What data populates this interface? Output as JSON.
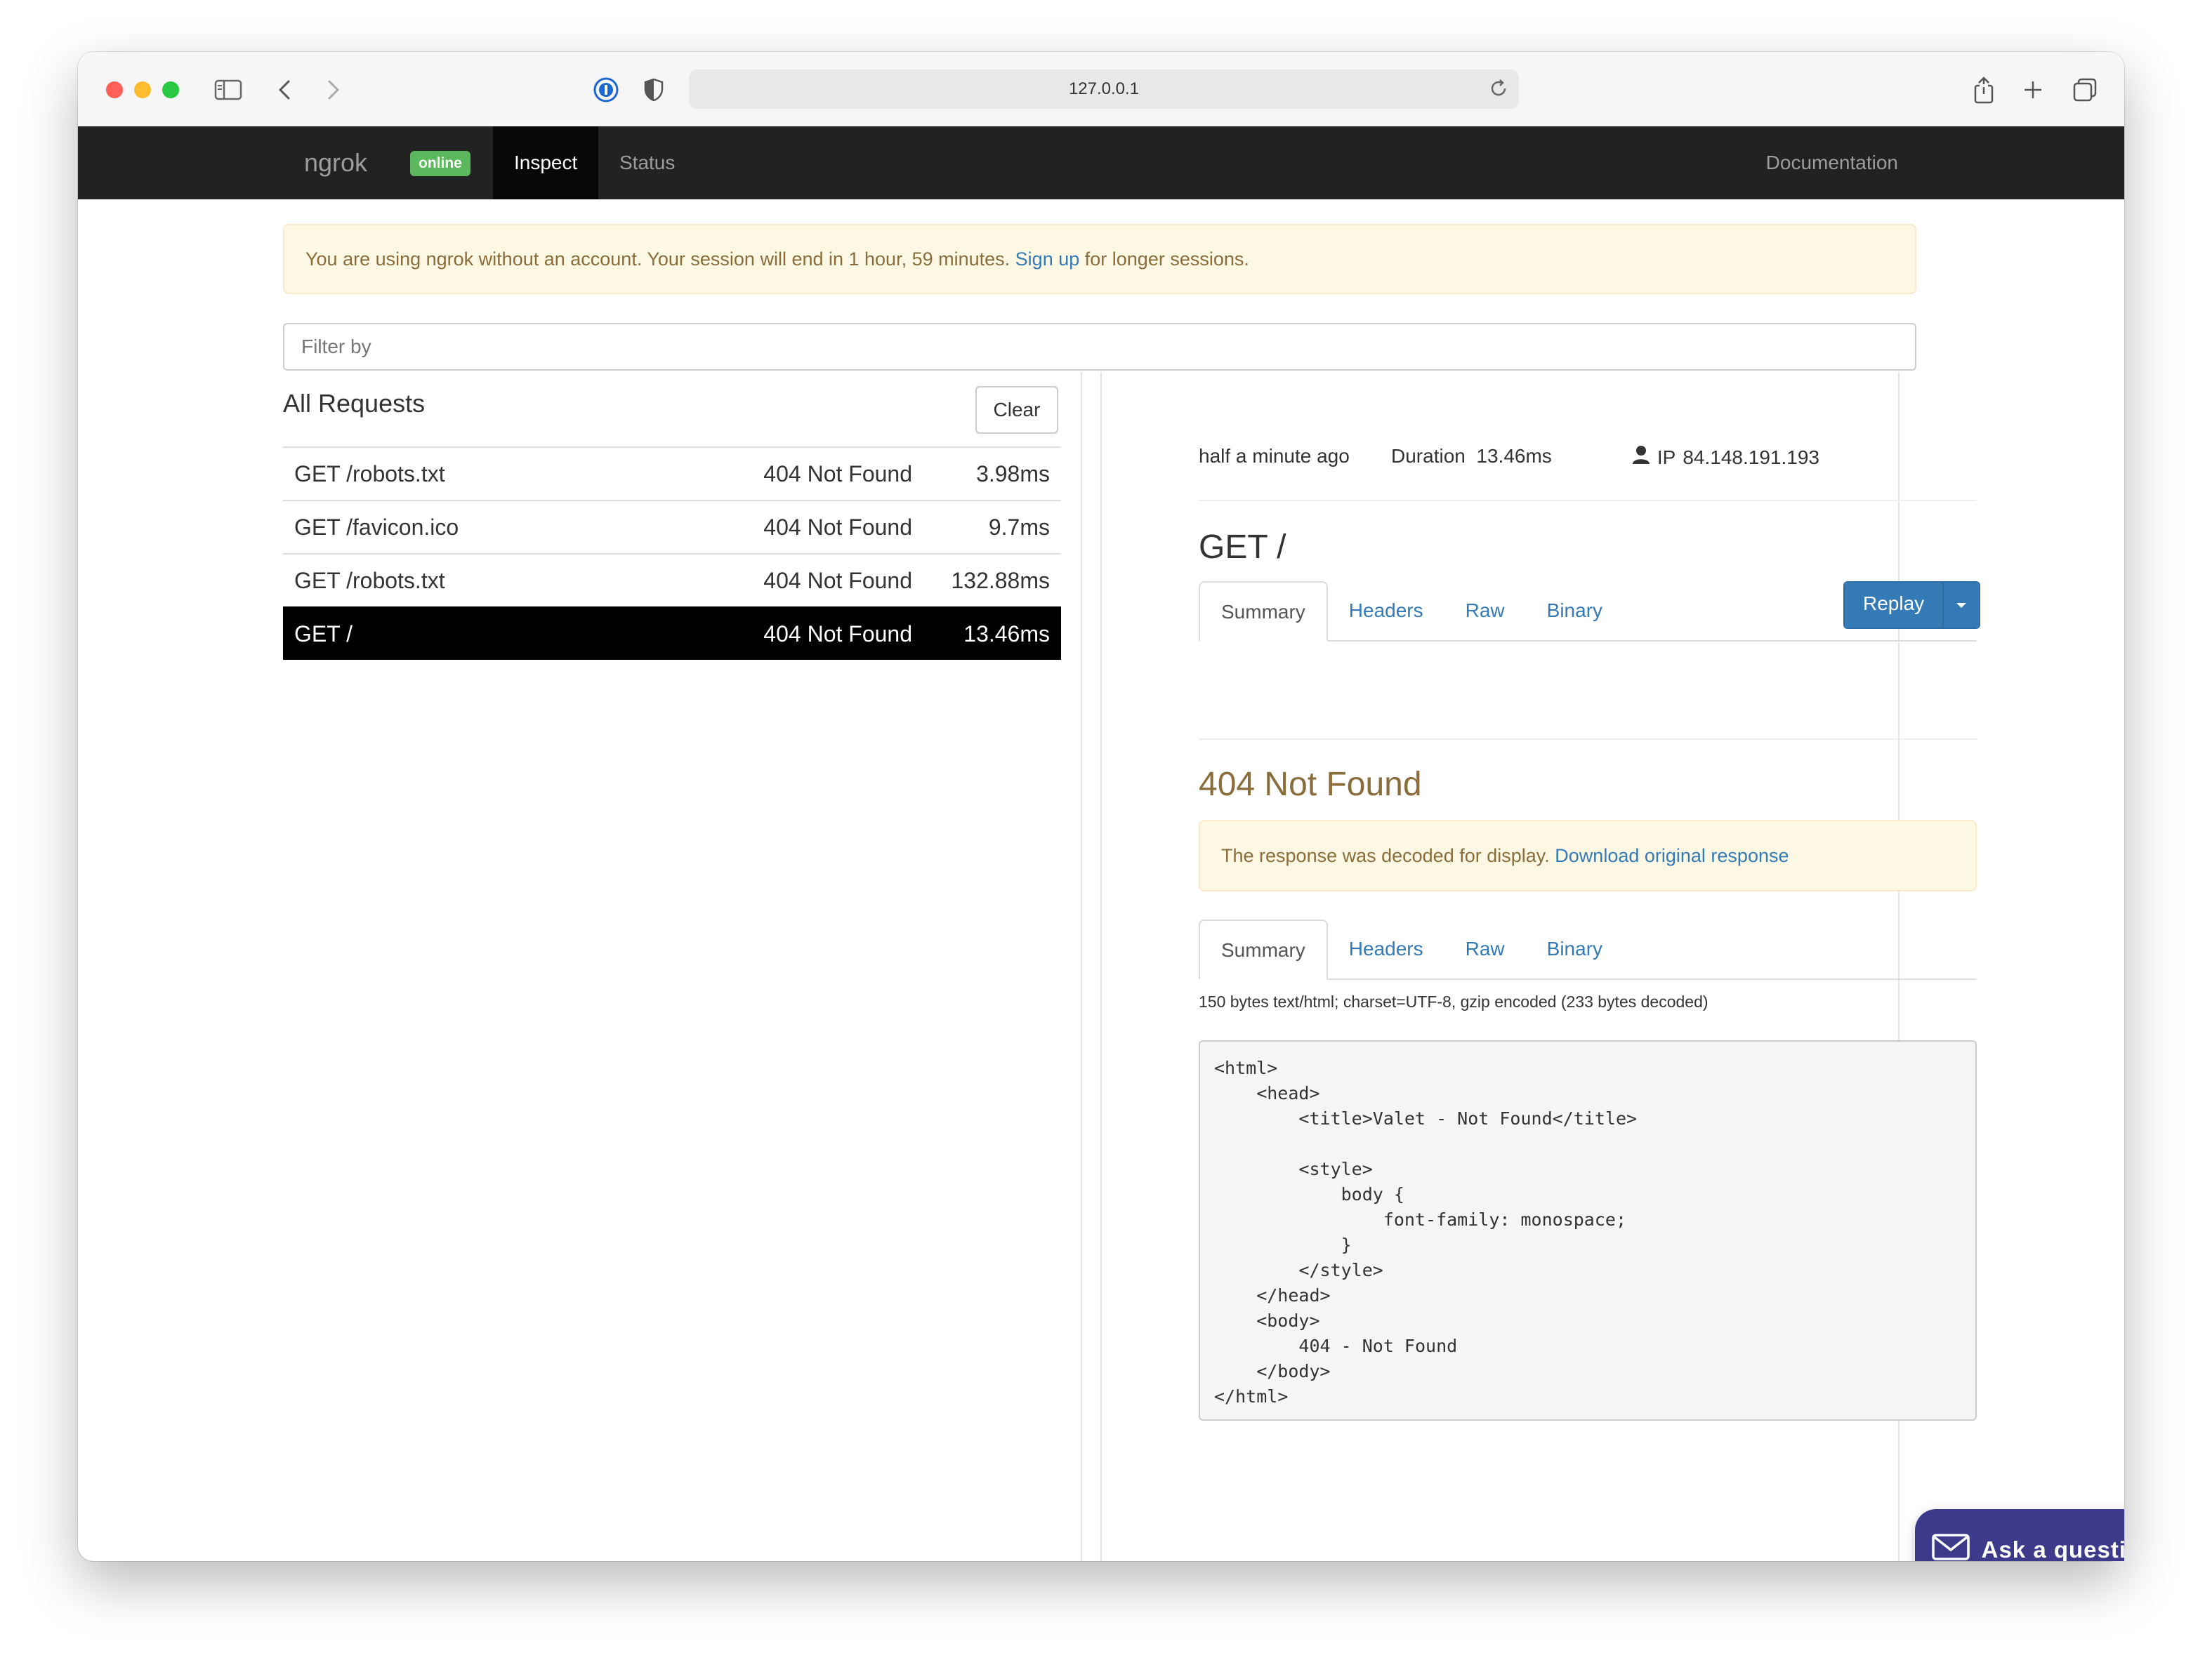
{
  "browser": {
    "url": "127.0.0.1"
  },
  "navbar": {
    "brand": "ngrok",
    "status_badge": "online",
    "tabs": [
      {
        "label": "Inspect",
        "active": true
      },
      {
        "label": "Status",
        "active": false
      }
    ],
    "documentation": "Documentation"
  },
  "session_alert": {
    "text": "You are using ngrok without an account. Your session will end in 1 hour, 59 minutes.",
    "link": "Sign up",
    "suffix": "for longer sessions."
  },
  "filter": {
    "placeholder": "Filter by"
  },
  "requests": {
    "title": "All Requests",
    "clear_label": "Clear",
    "rows": [
      {
        "path": "GET /robots.txt",
        "status": "404 Not Found",
        "duration": "3.98ms",
        "selected": false
      },
      {
        "path": "GET /favicon.ico",
        "status": "404 Not Found",
        "duration": "9.7ms",
        "selected": false
      },
      {
        "path": "GET /robots.txt",
        "status": "404 Not Found",
        "duration": "132.88ms",
        "selected": false
      },
      {
        "path": "GET /",
        "status": "404 Not Found",
        "duration": "13.46ms",
        "selected": true
      }
    ]
  },
  "detail": {
    "time": "half a minute ago",
    "duration_label": "Duration",
    "duration_value": "13.46ms",
    "ip_label": "IP",
    "ip_value": "84.148.191.193",
    "request_title": "GET /",
    "request_tabs": [
      "Summary",
      "Headers",
      "Raw",
      "Binary"
    ],
    "replay_label": "Replay",
    "response_title": "404 Not Found",
    "decoded_notice": "The response was decoded for display.",
    "download_link": "Download original response",
    "response_tabs": [
      "Summary",
      "Headers",
      "Raw",
      "Binary"
    ],
    "response_info": "150 bytes text/html; charset=UTF-8, gzip encoded (233 bytes decoded)",
    "body": "<html>\n    <head>\n        <title>Valet - Not Found</title>\n\n        <style>\n            body {\n                font-family: monospace;\n            }\n        </style>\n    </head>\n    <body>\n        404 - Not Found\n    </body>\n</html>"
  },
  "support": {
    "ask_label": "Ask a question"
  },
  "colors": {
    "navbar_bg": "#222222",
    "online_badge": "#5cb85c",
    "selected_row": "#000000",
    "link": "#337ab7",
    "alert_bg": "#fcf8e3",
    "response_status": "#8a6d3b",
    "ask_button": "#3d3a8c"
  },
  "icons": {
    "sidebar": "sidebar-icon",
    "back": "chevron-left-icon",
    "forward": "chevron-right-icon",
    "password": "password-manager-icon",
    "shield": "shield-icon",
    "reload": "reload-icon",
    "share": "share-icon",
    "new_tab": "plus-icon",
    "tabs": "tabs-overview-icon",
    "user": "user-icon",
    "mail": "mail-icon"
  }
}
